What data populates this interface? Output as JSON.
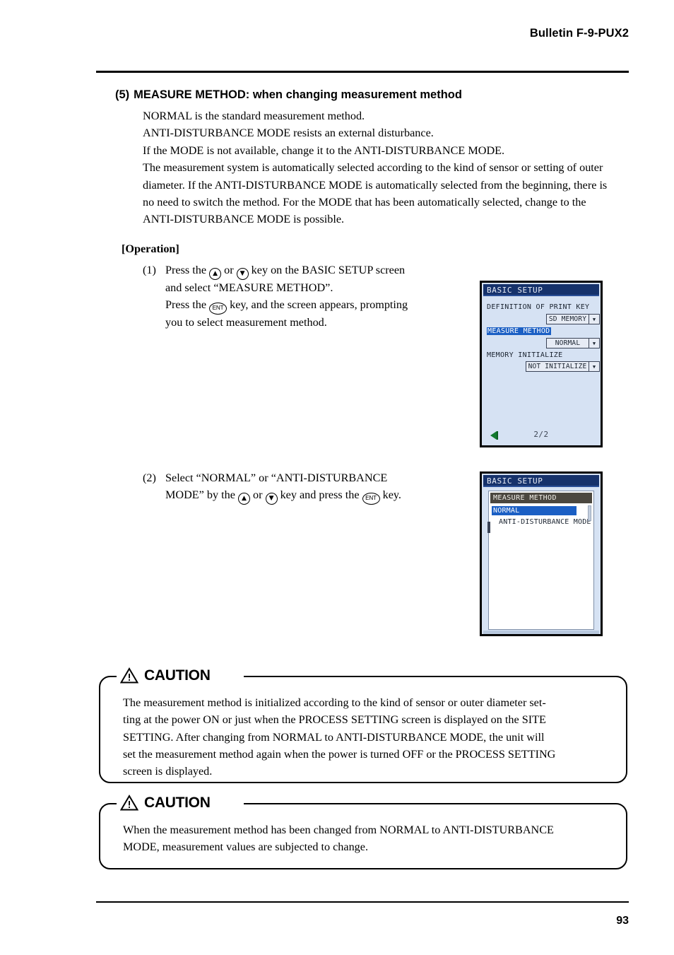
{
  "header": {
    "bulletin": "Bulletin F-9-PUX2"
  },
  "section": {
    "number": "(5)",
    "title": "MEASURE METHOD:  when changing measurement method",
    "intro_lines": [
      "NORMAL is the standard measurement method.",
      "ANTI-DISTURBANCE MODE resists an external disturbance.",
      "If the MODE is not available, change it to the ANTI-DISTURBANCE MODE."
    ],
    "intro_paragraph": "The measurement system is automatically selected according to the kind of sensor or setting of outer diameter.  If the ANTI-DISTURBANCE MODE is automatically selected from the beginning, there is no need to switch the method.  For the MODE that has been automatically selected, change to the ANTI-DISTURBANCE MODE is possible."
  },
  "operation": {
    "label": "[Operation]",
    "steps": [
      {
        "marker": "(1)",
        "line1_a": "Press the",
        "line1_b": "or",
        "line1_c": "key on the BASIC SETUP screen",
        "line2": "and select “MEASURE METHOD”.",
        "line3_a": "Press the",
        "line3_b": "key, and the screen appears, prompting",
        "line4": "you to select measurement method."
      },
      {
        "marker": "(2)",
        "line1": "Select “NORMAL” or “ANTI-DISTURBANCE",
        "line2_a": "MODE” by the",
        "line2_b": "or",
        "line2_c": "key and press the",
        "line2_d": "key."
      }
    ],
    "keys": {
      "up": "▲",
      "down": "▼",
      "ent": "ENT"
    }
  },
  "lcd_screen_1": {
    "title": "BASIC SETUP",
    "rows": [
      {
        "label": "DEFINITION OF PRINT KEY",
        "value": "SD MEMORY",
        "highlighted": false
      },
      {
        "label": "MEASURE METHOD",
        "value": "NORMAL",
        "highlighted": true
      },
      {
        "label": "MEMORY INITIALIZE",
        "value": "NOT INITIALIZE",
        "highlighted": false
      }
    ],
    "page_indicator": "2/2",
    "back_icon": "back-arrow-icon",
    "colors": {
      "titlebar": "#16326b",
      "background": "#d6e2f3",
      "highlight": "#1b5fc4",
      "back_arrow": "#127a2e"
    }
  },
  "lcd_screen_2": {
    "title": "BASIC SETUP",
    "dialog_title": "MEASURE METHOD",
    "options": [
      {
        "label": "NORMAL",
        "selected": true
      },
      {
        "label": "ANTI-DISTURBANCE MODE",
        "selected": false
      }
    ],
    "colors": {
      "titlebar": "#16326b",
      "dialog_title": "#4b473f",
      "highlight": "#1b5fc4",
      "background": "#d6e2f3"
    }
  },
  "cautions": [
    {
      "word": "CAUTION",
      "lines": [
        "The measurement method is initialized according to the kind of sensor or outer diameter set-",
        "ting at the power ON or just when the PROCESS SETTING screen is displayed on the SITE",
        "SETTING.  After changing from NORMAL to ANTI-DISTURBANCE MODE, the unit will",
        "set the measurement method again when the power is turned OFF or the PROCESS SETTING",
        "screen is displayed."
      ]
    },
    {
      "word": "CAUTION",
      "lines": [
        "When the measurement method has been changed from NORMAL to ANTI-DISTURBANCE",
        "MODE, measurement values are subjected to change."
      ]
    }
  ],
  "footer": {
    "page_number": "93"
  }
}
